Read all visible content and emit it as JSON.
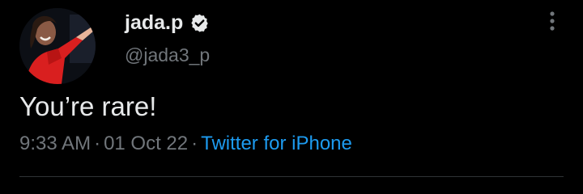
{
  "tweet": {
    "display_name": "jada.p",
    "handle": "@jada3_p",
    "text": "You’re rare!",
    "time": "9:33 AM",
    "separator": "·",
    "date": "01 Oct 22",
    "source": "Twitter for iPhone"
  },
  "icons": {
    "verified": "verified-badge-icon",
    "more": "more-vertical-icon",
    "avatar": "profile-photo"
  },
  "colors": {
    "background": "#000000",
    "primary_text": "#e7e9ea",
    "secondary_text": "#71767b",
    "link": "#1d9bf0",
    "divider": "#2f3336"
  }
}
